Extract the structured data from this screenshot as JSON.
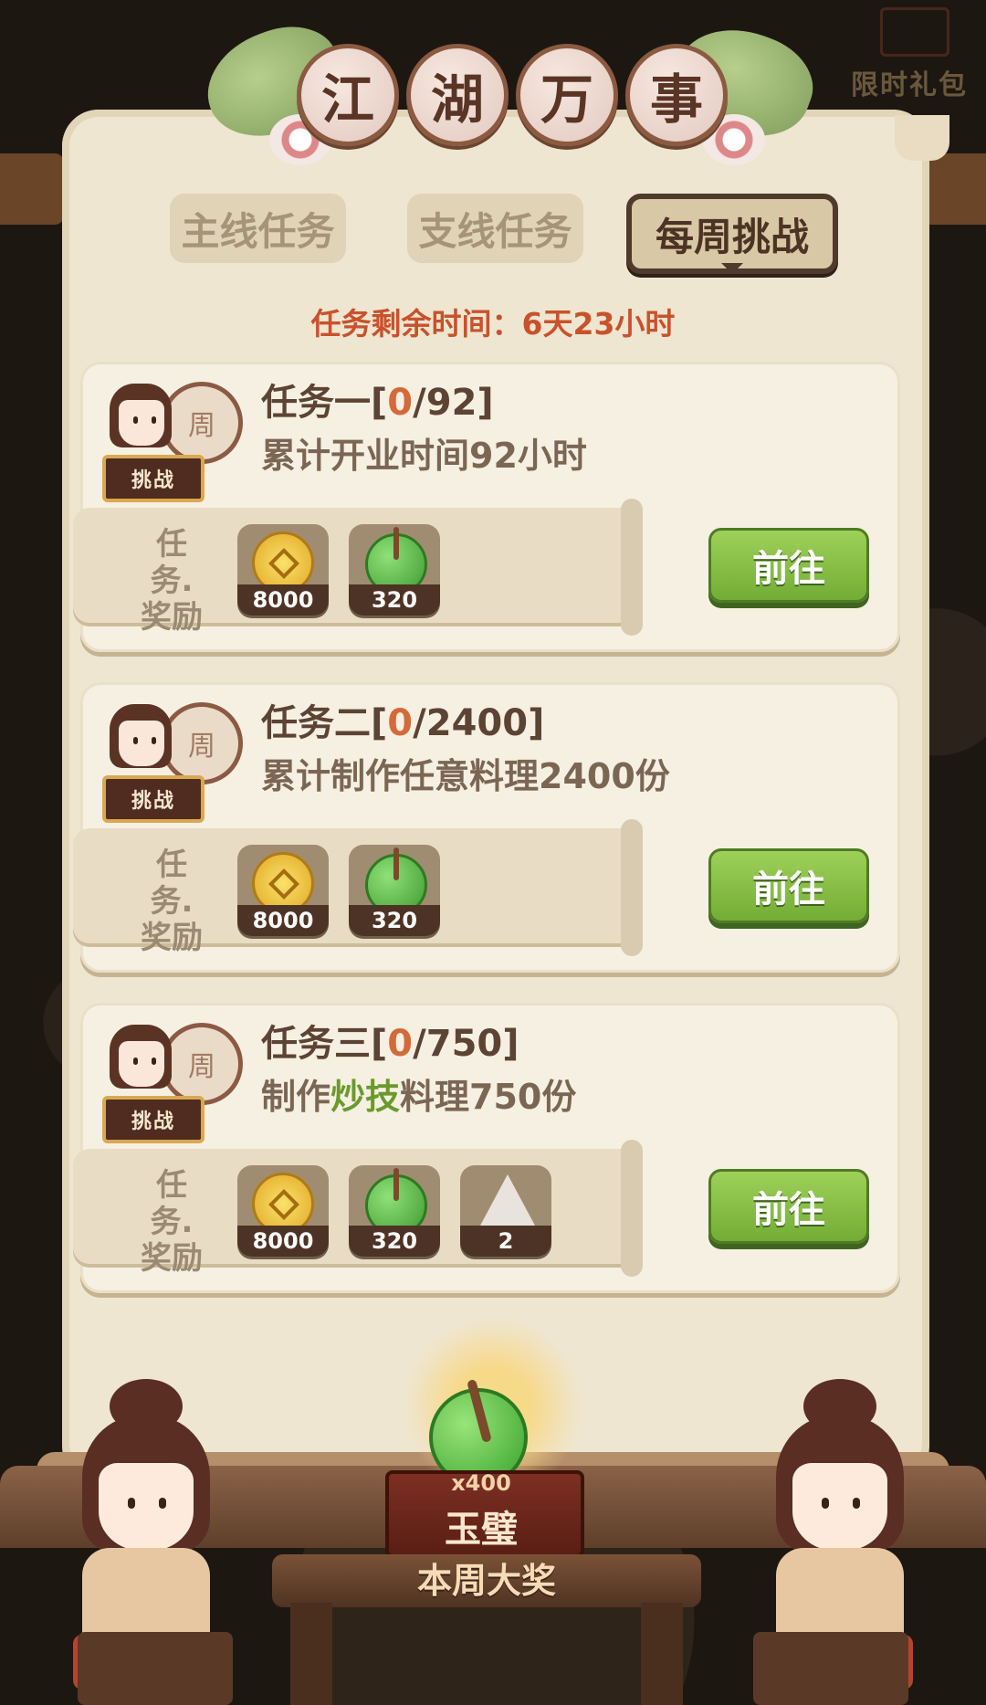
{
  "corner": {
    "gift_label": "限时礼包"
  },
  "header": {
    "title_chars": [
      "江",
      "湖",
      "万",
      "事"
    ]
  },
  "tabs": [
    {
      "label": "主线任务",
      "active": false
    },
    {
      "label": "支线任务",
      "active": false
    },
    {
      "label": "每周挑战",
      "active": true
    }
  ],
  "timer": {
    "label": "任务剩余时间：6天23小时"
  },
  "avatar": {
    "coin_char": "周",
    "badge": "挑战"
  },
  "reward_label_line1": "任务.",
  "reward_label_line2": "奖励",
  "go_label": "前往",
  "tasks": [
    {
      "name": "任务一",
      "current": "0",
      "target": "/92",
      "desc_pre": "累计开业时间92小时",
      "desc_hl": "",
      "desc_post": "",
      "rewards": [
        {
          "icon": "gold-coin",
          "count": "8000"
        },
        {
          "icon": "jade-disc",
          "count": "320"
        }
      ]
    },
    {
      "name": "任务二",
      "current": "0",
      "target": "/2400",
      "desc_pre": "累计制作任意料理2400份",
      "desc_hl": "",
      "desc_post": "",
      "rewards": [
        {
          "icon": "gold-coin",
          "count": "8000"
        },
        {
          "icon": "jade-disc",
          "count": "320"
        }
      ]
    },
    {
      "name": "任务三",
      "current": "0",
      "target": "/750",
      "desc_pre": "制作",
      "desc_hl": "炒技",
      "desc_post": "料理750份",
      "rewards": [
        {
          "icon": "gold-coin",
          "count": "8000"
        },
        {
          "icon": "jade-disc",
          "count": "320"
        },
        {
          "icon": "zongzi",
          "count": "2"
        }
      ]
    }
  ],
  "grand_prize": {
    "qty": "x400",
    "name": "玉璧",
    "caption": "本周大奖"
  },
  "colors": {
    "accent_red": "#c8522c",
    "progress_current": "#d46a3a",
    "highlight_green": "#6a9a2e",
    "button_green": "#73ad35"
  }
}
